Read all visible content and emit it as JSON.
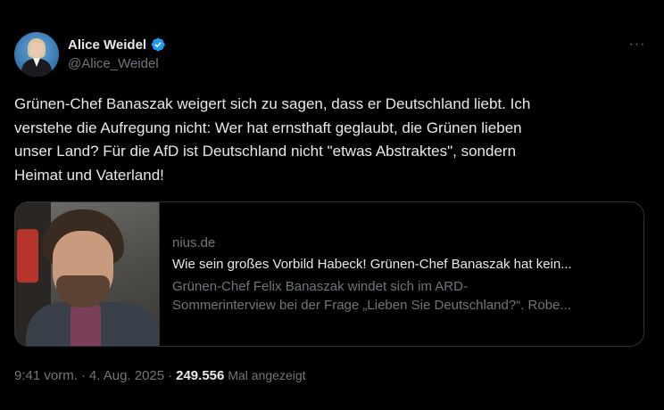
{
  "author": {
    "display_name": "Alice Weidel",
    "handle": "@Alice_Weidel",
    "verified": true,
    "verified_color": "#1d9bf0"
  },
  "menu": {
    "more_label": "···"
  },
  "tweet": {
    "text": "Grünen-Chef Banaszak weigert sich zu sagen, dass er Deutschland liebt. Ich\nverstehe die Aufregung nicht: Wer hat ernsthaft geglaubt, die Grünen lieben\nunser Land? Für die AfD ist Deutschland nicht \"etwas Abstraktes\", sondern\nHeimat und Vaterland!"
  },
  "link_card": {
    "domain": "nius.de",
    "title": "Wie sein großes Vorbild Habeck! Grünen-Chef Banaszak hat kein...",
    "description_line1": "Grünen-Chef Felix Banaszak windet sich im ARD-",
    "description_line2": "Sommerinterview bei der Frage „Lieben Sie Deutschland?“. Robe..."
  },
  "meta": {
    "time": "9:41 vorm.",
    "separator": "·",
    "date": "4. Aug. 2025",
    "views": "249.556",
    "views_label": "Mal angezeigt"
  },
  "colors": {
    "background": "#000000",
    "text_primary": "#e7e9ea",
    "text_secondary": "#71767b",
    "border": "#2f3336"
  }
}
